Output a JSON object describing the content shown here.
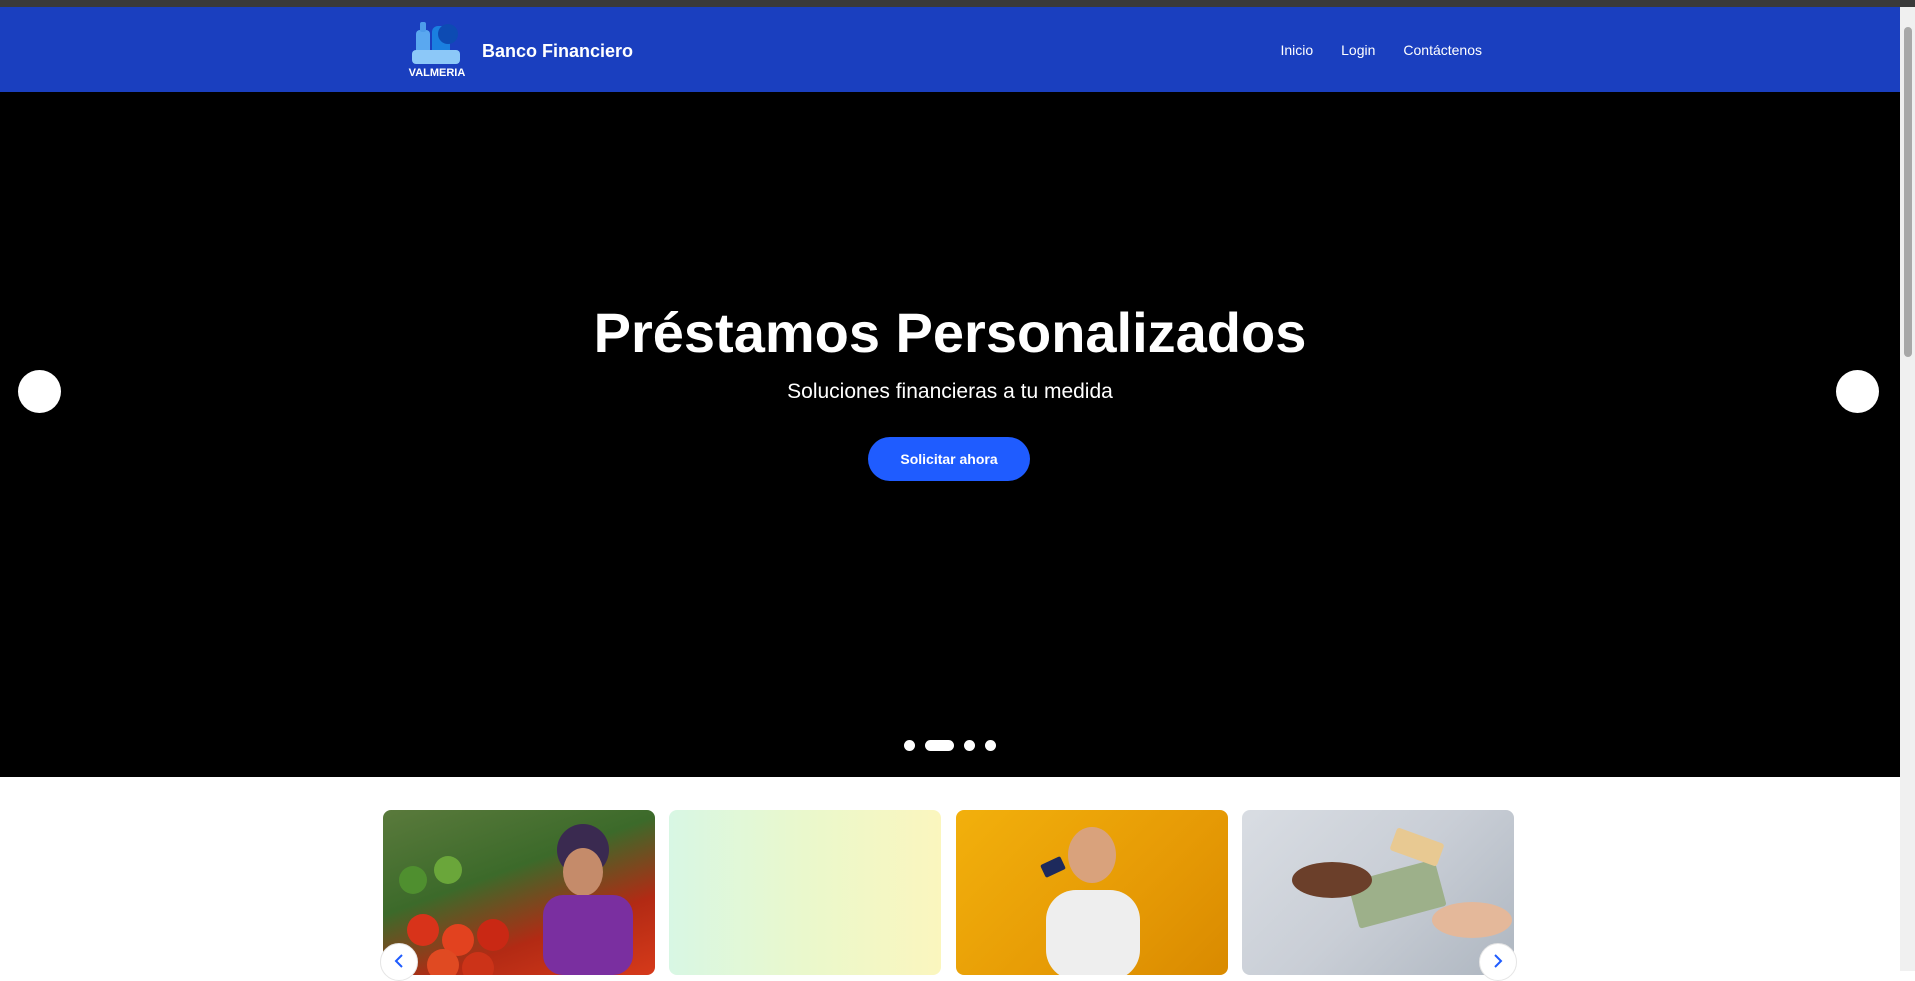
{
  "brand": {
    "name": "Banco Financiero",
    "logo_text": "VALMERIA"
  },
  "nav": {
    "items": [
      {
        "label": "Inicio"
      },
      {
        "label": "Login"
      },
      {
        "label": "Contáctenos"
      }
    ]
  },
  "hero": {
    "title": "Préstamos Personalizados",
    "subtitle": "Soluciones financieras a tu medida",
    "cta_label": "Solicitar ahora",
    "slide_count": 4,
    "active_slide": 2
  },
  "cards": [
    {
      "image": "market-vendor-photo"
    },
    {
      "image": "gradient-placeholder"
    },
    {
      "image": "man-with-card-photo"
    },
    {
      "image": "cash-handover-photo"
    }
  ],
  "colors": {
    "navbar": "#1a3fbf",
    "hero_background": "#000000",
    "cta_button": "#1f5cff"
  }
}
